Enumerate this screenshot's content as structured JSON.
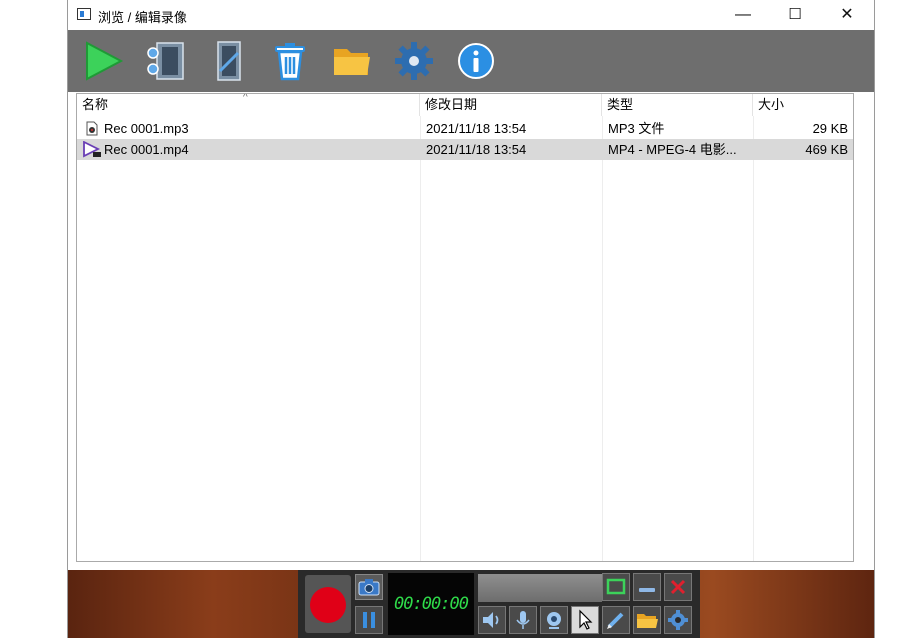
{
  "window": {
    "title": "浏览 / 编辑录像",
    "minimize_glyph": "—",
    "maximize_glyph": "☐",
    "close_glyph": "✕"
  },
  "toolbar": {
    "items": [
      {
        "name": "play-icon"
      },
      {
        "name": "cut-film-icon"
      },
      {
        "name": "edit-film-icon"
      },
      {
        "name": "delete-icon"
      },
      {
        "name": "folder-icon"
      },
      {
        "name": "settings-icon"
      },
      {
        "name": "info-icon"
      }
    ]
  },
  "list": {
    "columns": {
      "name": "名称",
      "date": "修改日期",
      "type": "类型",
      "size": "大小"
    },
    "sort_indicator": "^",
    "rows": [
      {
        "name": "Rec 0001.mp3",
        "date": "2021/11/18 13:54",
        "type": "MP3 文件",
        "size": "29 KB",
        "icon": "audio-file-icon",
        "selected": false
      },
      {
        "name": "Rec 0001.mp4",
        "date": "2021/11/18 13:54",
        "type": "MP4 - MPEG-4 电影...",
        "size": "469 KB",
        "icon": "video-file-icon",
        "selected": true
      }
    ]
  },
  "recorder": {
    "timer": "00:00:00",
    "colors": {
      "record": "#e00017",
      "timer_text": "#2fdb4a",
      "accent_green": "#3cd25a",
      "close_red": "#e0202e"
    }
  }
}
